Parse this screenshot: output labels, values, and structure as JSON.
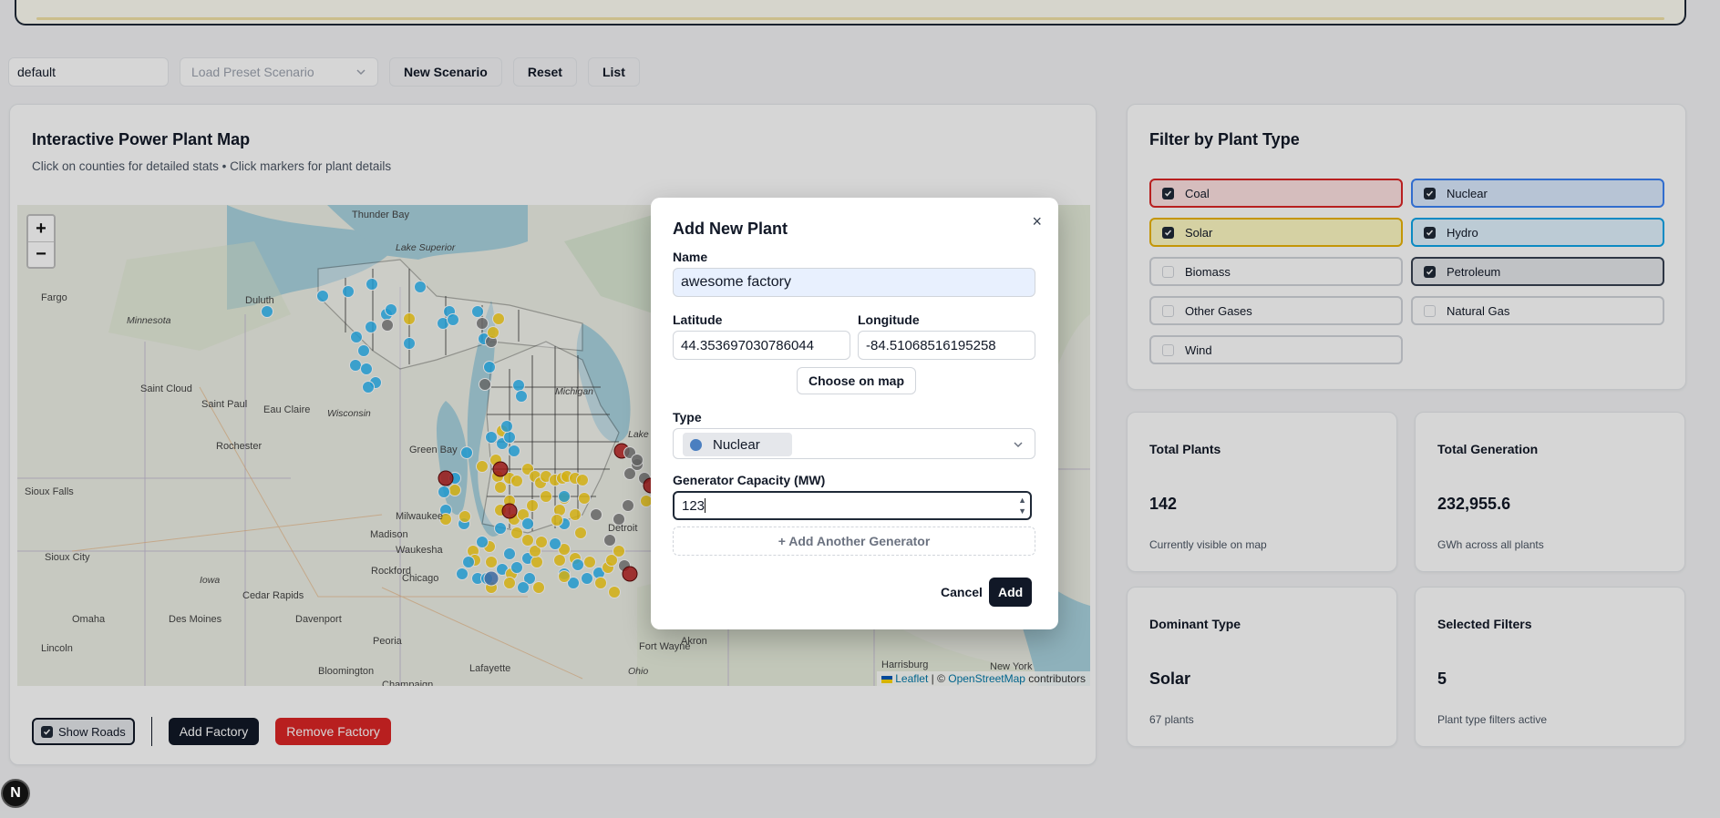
{
  "toolbar": {
    "scenario_name": "default",
    "preset_placeholder": "Load Preset Scenario",
    "new_scenario": "New Scenario",
    "reset": "Reset",
    "list": "List"
  },
  "map_panel": {
    "title": "Interactive Power Plant Map",
    "subtitle": "Click on counties for detailed stats • Click markers for plant details",
    "zoom_in": "+",
    "zoom_out": "−",
    "attribution": {
      "leaflet": "Leaflet",
      "separator": " | © ",
      "osm": "OpenStreetMap",
      "contributors": " contributors"
    },
    "place_labels": [
      "Thunder Bay",
      "Lake Superior",
      "Duluth",
      "Fargo",
      "Minnesota",
      "Saint Cloud",
      "Saint Paul",
      "Eau Claire",
      "Wisconsin",
      "Rochester",
      "Green Bay",
      "Sioux Falls",
      "Milwaukee",
      "Madison",
      "Waukesha",
      "Sioux City",
      "Rockford",
      "Chicago",
      "Iowa",
      "Cedar Rapids",
      "Omaha",
      "Des Moines",
      "Davenport",
      "Lincoln",
      "Peoria",
      "Bloomington",
      "Champaign",
      "Fort Wayne",
      "Lafayette",
      "Ohio",
      "Akron",
      "Harrisburg",
      "New York",
      "Lake",
      "Detroit",
      "Michigan"
    ],
    "show_roads": "Show Roads",
    "add_factory": "Add Factory",
    "remove_factory": "Remove Factory"
  },
  "filter_panel": {
    "title": "Filter by Plant Type",
    "types": [
      {
        "label": "Coal",
        "checked": true,
        "color": "#dc2626"
      },
      {
        "label": "Nuclear",
        "checked": true,
        "color": "#3b82f6"
      },
      {
        "label": "Solar",
        "checked": true,
        "color": "#eab308"
      },
      {
        "label": "Hydro",
        "checked": true,
        "color": "#0ea5e9"
      },
      {
        "label": "Biomass",
        "checked": false,
        "color": "#d1d5db"
      },
      {
        "label": "Petroleum",
        "checked": true,
        "color": "#374151"
      },
      {
        "label": "Other Gases",
        "checked": false,
        "color": "#d1d5db"
      },
      {
        "label": "Natural Gas",
        "checked": false,
        "color": "#d1d5db"
      },
      {
        "label": "Wind",
        "checked": false,
        "color": "#d1d5db"
      }
    ]
  },
  "stats": {
    "total_plants": {
      "label": "Total Plants",
      "value": "142",
      "sub": "Currently visible on map"
    },
    "total_generation": {
      "label": "Total Generation",
      "value": "232,955.6",
      "sub": "GWh across all plants"
    },
    "dominant_type": {
      "label": "Dominant Type",
      "value": "Solar",
      "sub": "67 plants"
    },
    "selected_filters": {
      "label": "Selected Filters",
      "value": "5",
      "sub": "Plant type filters active"
    }
  },
  "dialog": {
    "title": "Add New Plant",
    "close": "×",
    "name_label": "Name",
    "name_value": "awesome factory",
    "latitude_label": "Latitude",
    "latitude_value": "44.353697030786044",
    "longitude_label": "Longitude",
    "longitude_value": "-84.51068516195258",
    "choose_on_map": "Choose on map",
    "type_label": "Type",
    "type_value": "Nuclear",
    "capacity_label": "Generator Capacity (MW)",
    "capacity_value": "123",
    "add_generator": "+ Add Another Generator",
    "cancel": "Cancel",
    "add": "Add"
  },
  "badge": "N"
}
